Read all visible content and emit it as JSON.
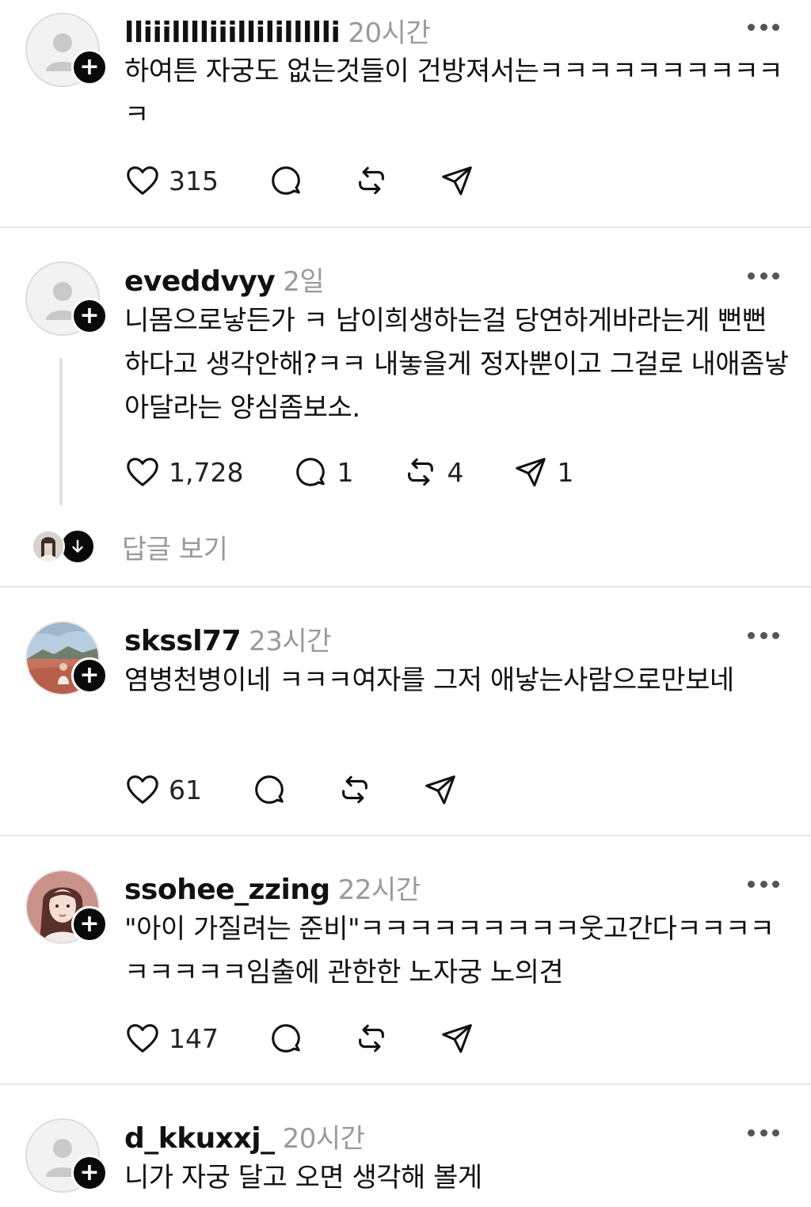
{
  "posts": [
    {
      "username": "lliiilllliiillilillllli",
      "time": "20시간",
      "avatar": "default-person-icon",
      "text": "하여튼 자궁도 없는것들이 건방져서는ㅋㅋㅋㅋㅋㅋㅋㅋㅋㅋㅋ",
      "likes": "315",
      "comments": "",
      "reposts": "",
      "shares": ""
    },
    {
      "username": "eveddvyy",
      "time": "2일",
      "avatar": "default-person-icon",
      "text": "니몸으로낳든가 ㅋ 남이희생하는걸 당연하게바라는게 뻔뻔하다고 생각안해?ㅋㅋ 내놓을게 정자뿐이고 그걸로 내애좀낳아달라는 양심좀보소.",
      "likes": "1,728",
      "comments": "1",
      "reposts": "4",
      "shares": "1",
      "view_replies_label": "답글 보기"
    },
    {
      "username": "skssl77",
      "time": "23시간",
      "avatar": "landscape-photo",
      "text": "염병천병이네 ㅋㅋㅋ여자를 그저 애낳는사람으로만보네",
      "likes": "61",
      "comments": "",
      "reposts": "",
      "shares": ""
    },
    {
      "username": "ssohee_zzing",
      "time": "22시간",
      "avatar": "portrait-photo",
      "text": "\"아이 가질려는 준비\"ㅋㅋㅋㅋㅋㅋㅋㅋㅋ웃고간다ㅋㅋㅋㅋㅋㅋㅋㅋㅋ임출에 관한한 노자궁 노의견",
      "likes": "147",
      "comments": "",
      "reposts": "",
      "shares": ""
    },
    {
      "username": "d_kkuxxj_",
      "time": "20시간",
      "avatar": "default-person-icon",
      "text": "니가 자궁 달고 오면 생각해 볼게"
    }
  ],
  "icons": {
    "like": "heart-icon",
    "comment": "comment-bubble-icon",
    "repost": "repost-arrows-icon",
    "share": "paper-plane-icon",
    "follow": "plus-icon",
    "more": "more-dots-icon",
    "expand": "arrow-down-icon"
  }
}
